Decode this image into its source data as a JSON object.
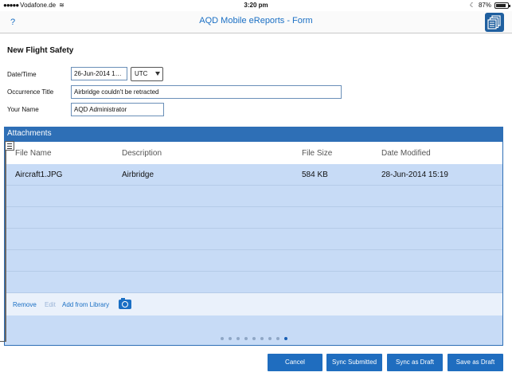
{
  "status_bar": {
    "carrier": "Vodafone.de",
    "time": "3:20 pm",
    "battery": "87%",
    "battery_level": 0.87
  },
  "nav": {
    "help": "?",
    "title": "AQD Mobile eReports - Form"
  },
  "form": {
    "title": "New Flight Safety",
    "fields": {
      "date_time_label": "Date/Time",
      "date_value": "26-Jun-2014 1…",
      "timezone": "UTC",
      "occurrence_title_label": "Occurrence Title",
      "occurrence_title_value": "Airbridge couldn't be retracted",
      "your_name_label": "Your Name",
      "your_name_value": "AQD Administrator"
    }
  },
  "attachments": {
    "header": "Attachments",
    "columns": [
      "File Name",
      "Description",
      "File Size",
      "Date Modified"
    ],
    "rows": [
      {
        "file_name": "Aircraft1.JPG",
        "description": "Airbridge",
        "file_size": "584 KB",
        "date_modified": "28-Jun-2014 15:19"
      }
    ],
    "toolbar": {
      "remove": "Remove",
      "edit": "Edit",
      "add_from_library": "Add from Library"
    },
    "pager": {
      "pages": 9,
      "current": 9
    }
  },
  "buttons": {
    "cancel": "Cancel",
    "sync_submitted": "Sync Submitted",
    "sync_as_draft": "Sync as Draft",
    "save_as_draft": "Save as Draft"
  },
  "colors": {
    "accent": "#1a6fc4",
    "panel_header": "#2e6fb6",
    "panel_body": "#c7dbf6",
    "button": "#1f6dbf"
  }
}
